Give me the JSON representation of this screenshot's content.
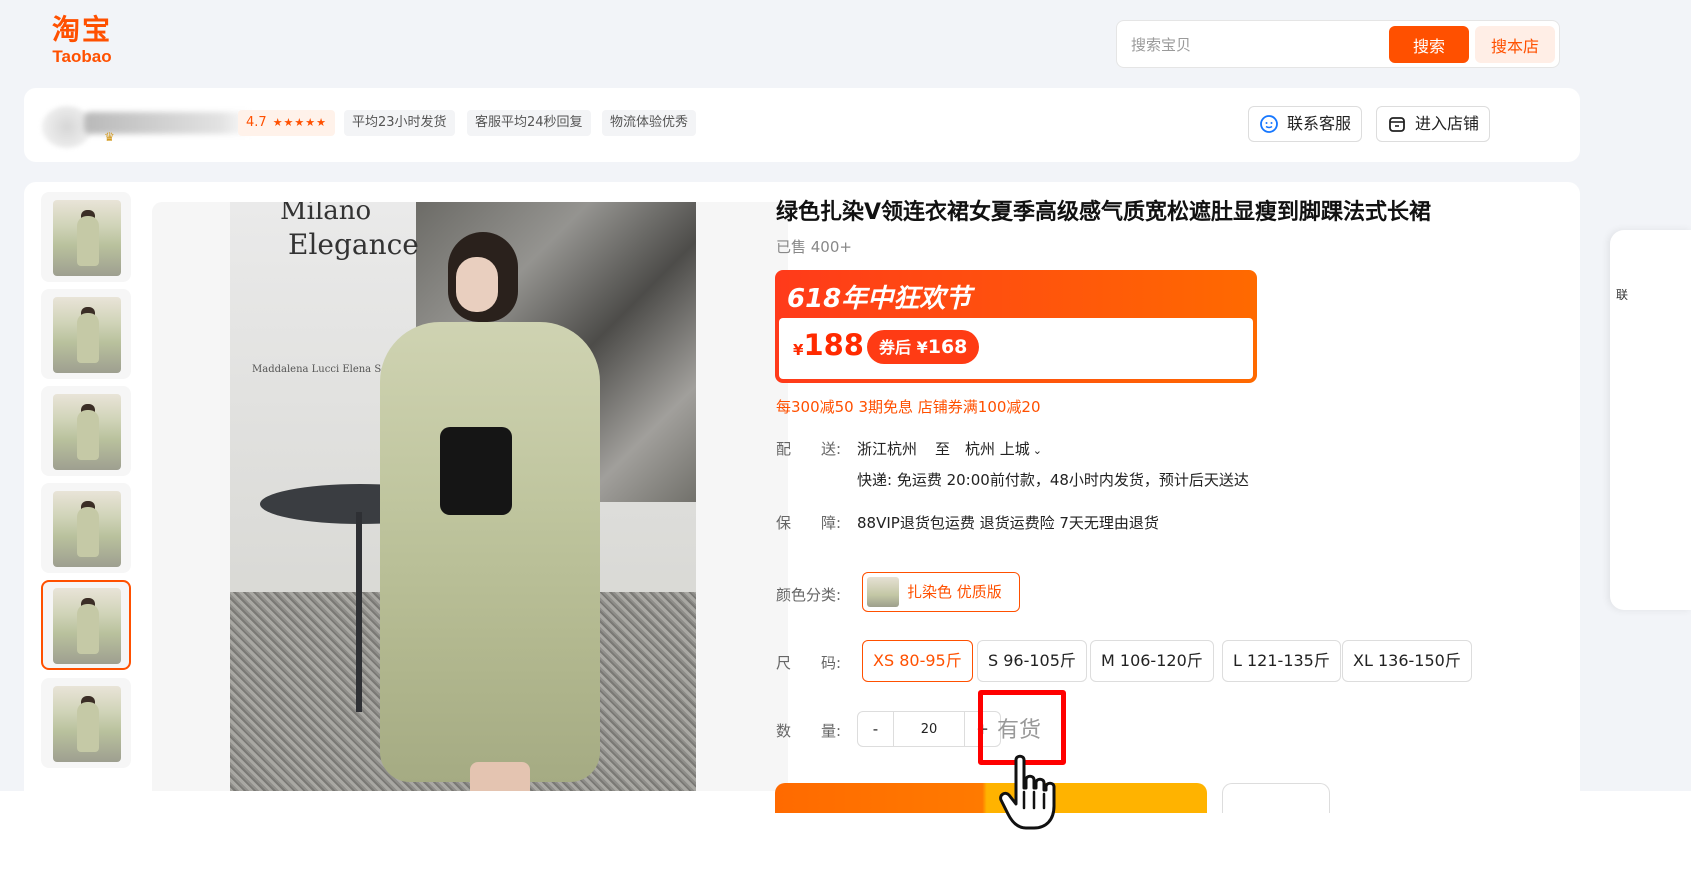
{
  "header": {
    "logo_cn": "淘宝",
    "logo_en": "Taobao",
    "search_placeholder": "搜索宝贝",
    "search_button": "搜索",
    "store_search_button": "搜本店"
  },
  "shop": {
    "rating": "4.7",
    "stars": "★★★★★",
    "tags": [
      "平均23小时发货",
      "客服平均24秒回复",
      "物流体验优秀"
    ],
    "contact_button": "联系客服",
    "enter_store_button": "进入店铺"
  },
  "product": {
    "title": "绿色扎染V领连衣裙女夏季高级感气质宽松遮肚显瘦到脚踝法式长裙",
    "sold": "已售 400+",
    "image_brand_1": "Milano",
    "image_brand_2": "Elegance",
    "image_brand_3": "Maddalena Lucci   Elena Serena   E",
    "promo": {
      "title": "618年中狂欢节",
      "currency": "¥",
      "price": "188",
      "coupon_label": "券后",
      "coupon_currency": "¥",
      "coupon_price": "168",
      "line": "每300减50 3期免息 店铺券满100减20"
    },
    "delivery": {
      "label": "配　　送:",
      "from": "浙江杭州",
      "to_word": "至",
      "to": "杭州 上城",
      "detail": "快递: 免运费  20:00前付款，48小时内发货，预计后天送达"
    },
    "guarantee": {
      "label": "保　　障:",
      "text": "88VIP退货包运费 退货运费险 7天无理由退货"
    },
    "color": {
      "label": "颜色分类:",
      "option": "扎染色 优质版"
    },
    "size": {
      "label": "尺　　码:",
      "options": [
        "XS 80-95斤",
        "S 96-105斤",
        "M 106-120斤",
        "L 121-135斤",
        "XL 136-150斤"
      ],
      "selected_index": 0
    },
    "quantity": {
      "label": "数　　量:",
      "minus": "-",
      "value": "20",
      "plus": "+",
      "stock": "有货"
    }
  },
  "colors": {
    "accent": "#ff5000",
    "highlight": "#ff0000"
  },
  "icons": [
    "service-icon",
    "store-icon",
    "hand-cursor-icon",
    "crown-icon"
  ]
}
